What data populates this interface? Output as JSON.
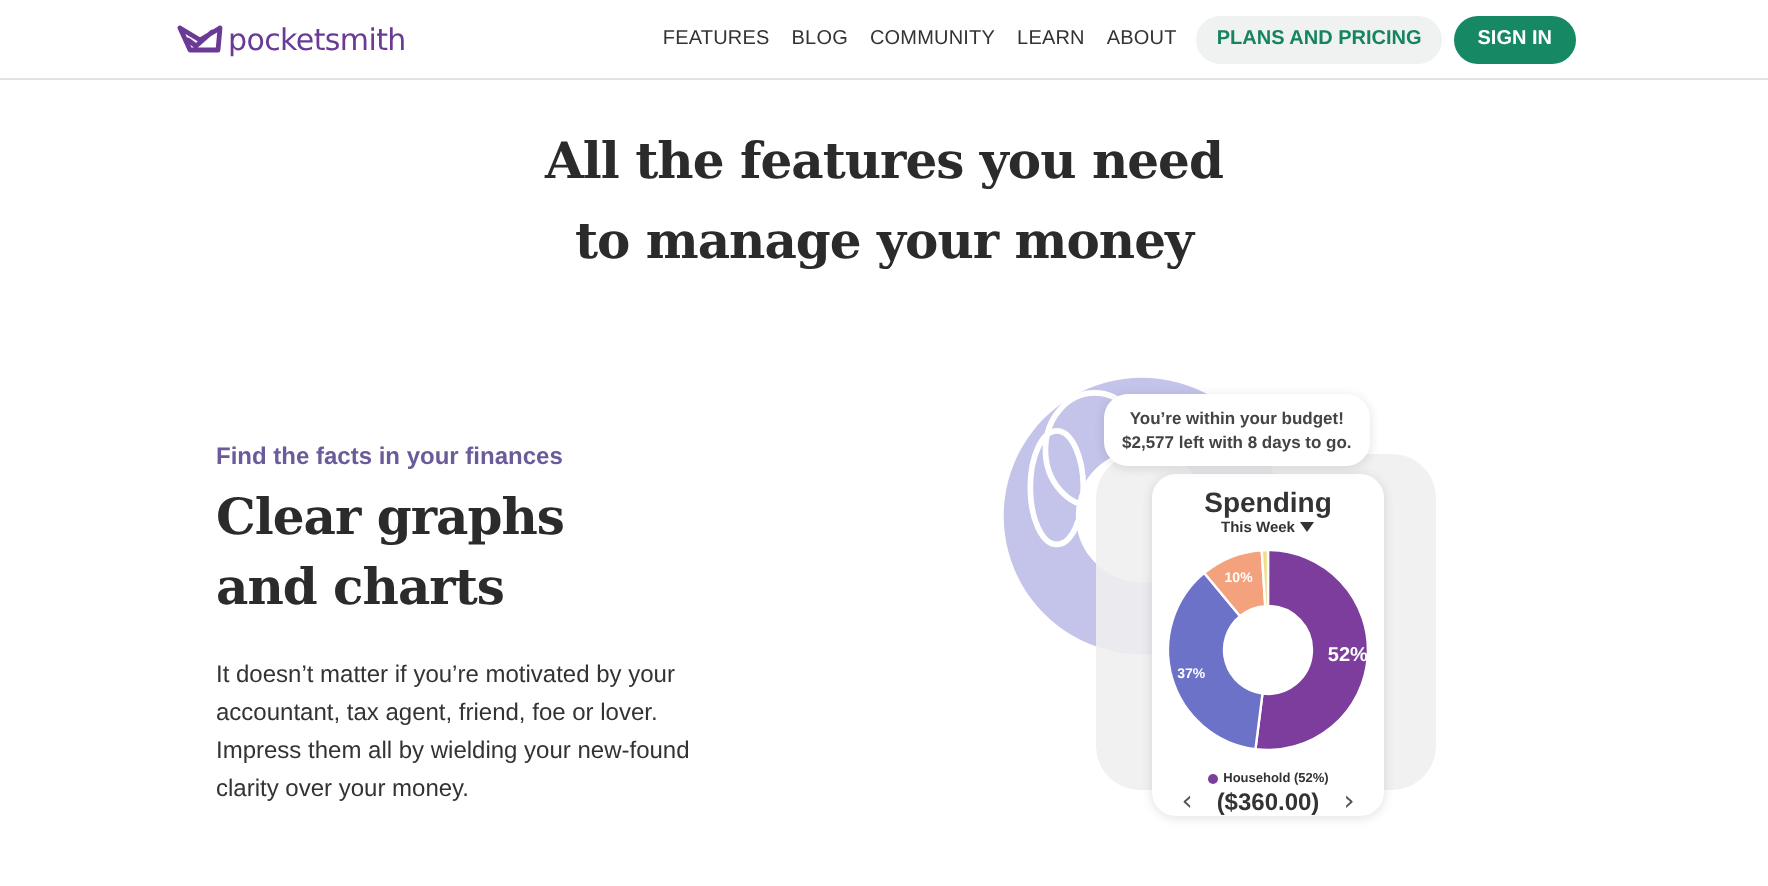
{
  "header": {
    "logo": "pocketsmith",
    "nav": [
      {
        "label": "FEATURES"
      },
      {
        "label": "BLOG"
      },
      {
        "label": "COMMUNITY"
      },
      {
        "label": "LEARN"
      },
      {
        "label": "ABOUT"
      }
    ],
    "buttons": [
      {
        "label": "PLANS AND PRICING",
        "kind": "secondary"
      },
      {
        "label": "SIGN IN",
        "kind": "primary"
      }
    ]
  },
  "hero": {
    "title_lines": [
      "All the features you need",
      "to manage your money"
    ]
  },
  "feature": {
    "eyebrow": "Find the facts in your finances",
    "title": "Clear graphs and charts",
    "body": "It doesn’t matter if you’re motivated by your accountant, tax agent, friend, foe or lover. Impress them all by wielding your new-found clarity over your money."
  },
  "illustration": {
    "bubble_lines": [
      "You’re within your budget!",
      "$2,577 left with 8 days to go."
    ],
    "card_title": "Spending",
    "period": "This Week",
    "legend": "Household (52%)",
    "amount": "($360.00)",
    "prev": "‹",
    "next": "›",
    "chart_data": {
      "type": "donut",
      "values": [
        52,
        37,
        10,
        1
      ],
      "value_labels": [
        "52%",
        "37%",
        "10%",
        null
      ]
    }
  }
}
